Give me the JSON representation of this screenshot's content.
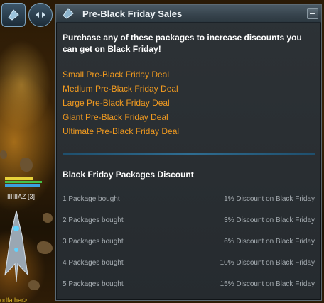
{
  "window": {
    "title": "Pre-Black Friday Sales",
    "intro": "Purchase any of these packages to increase discounts you can get on Black Friday!",
    "deals": [
      "Small Pre-Black Friday Deal",
      "Medium Pre-Black Friday Deal",
      "Large Pre-Black Friday Deal",
      "Giant Pre-Black Friday Deal",
      "Ultimate Pre-Black Friday Deal"
    ],
    "discount_section_title": "Black Friday Packages Discount",
    "discount_rows": [
      {
        "bought": "1 Package bought",
        "discount": "1% Discount on Black Friday"
      },
      {
        "bought": "2 Packages bought",
        "discount": "3% Discount on Black Friday"
      },
      {
        "bought": "3 Packages bought",
        "discount": "6% Discount on Black Friday"
      },
      {
        "bought": "4 Packages bought",
        "discount": "10% Discount on Black Friday"
      },
      {
        "bought": "5 Packages bought",
        "discount": "15% Discount on Black Friday"
      }
    ]
  },
  "game": {
    "player_name": "IIIIIIAZ [3]",
    "chat_fragment": "odfather>"
  },
  "colors": {
    "deal_link": "#f09a20",
    "divider": "#2f6d91",
    "window_bg": "#2b3034"
  },
  "icons": {
    "hud_button_1": "ship-icon",
    "hud_button_2": "double-arrow-icon",
    "title": "ship-icon",
    "minimize": "minimize-icon"
  }
}
